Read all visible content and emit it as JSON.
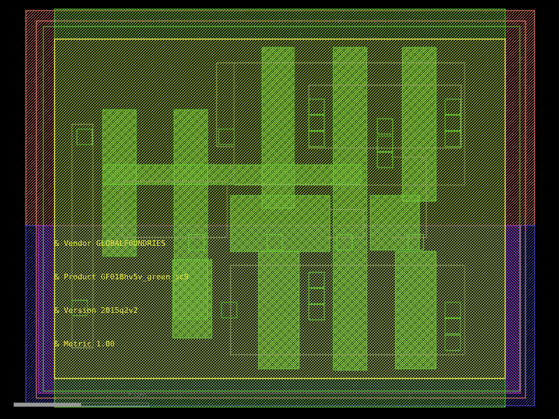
{
  "layout_view": {
    "labels": {
      "vendor": "& Vendor GLOBALFOUNDRIES",
      "product": "& Product GF018hv5v_green_sc9",
      "version": "& Version 2015q2v2",
      "metric": "& Metric 1.00"
    },
    "scale_bar": {
      "text": "2 µm"
    },
    "colors": {
      "background": "#000000",
      "nwell": "#ff8a70",
      "pwell": "#4b4bd6",
      "implant": "#c040c0",
      "diffusion": "#64c832",
      "poly": "#c8c832",
      "metal": "#8fa060",
      "highlight": "#ffff70"
    }
  }
}
